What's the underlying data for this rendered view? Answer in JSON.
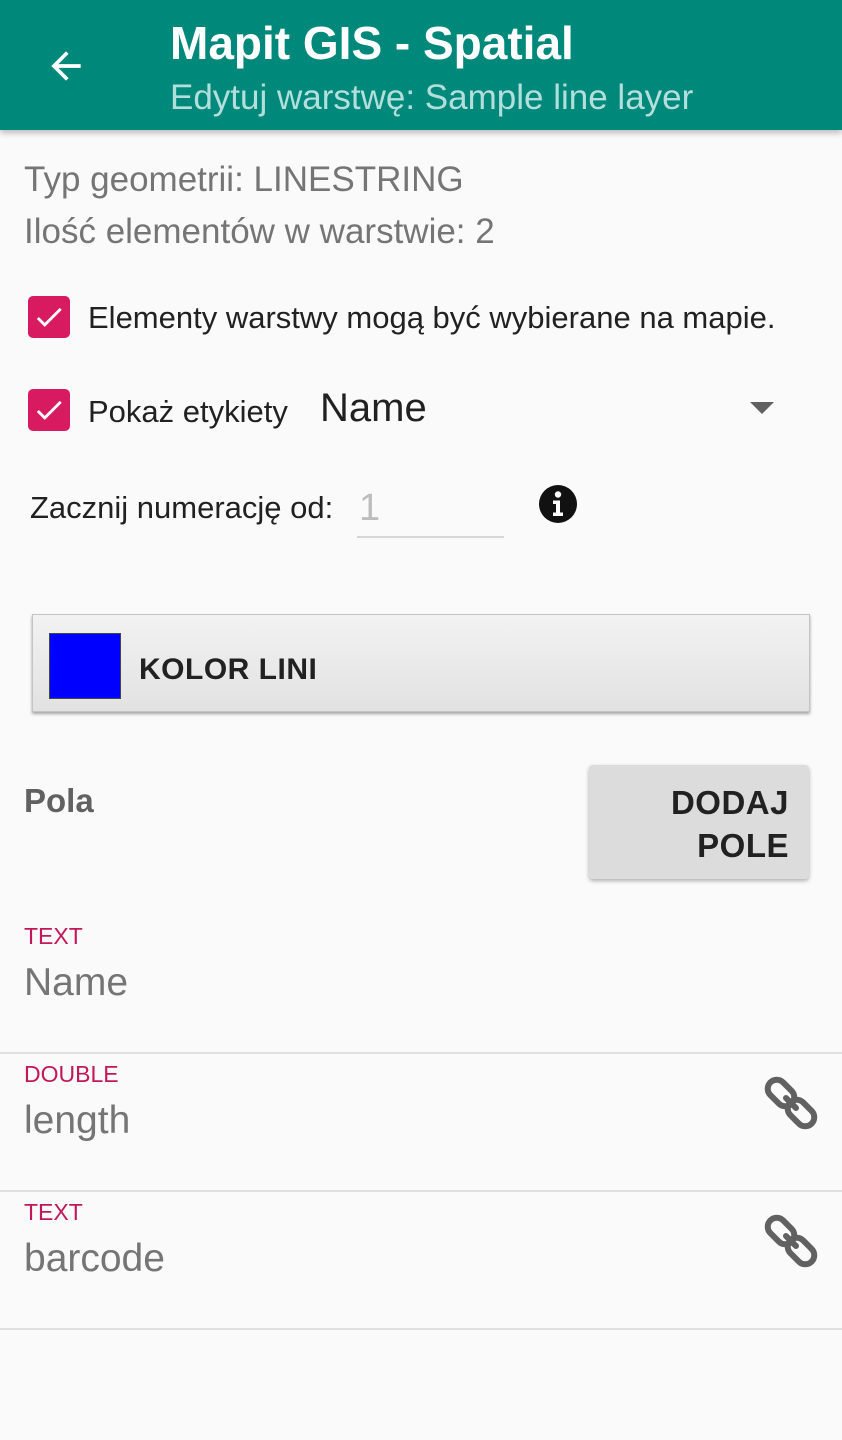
{
  "appbar": {
    "title": "Mapit GIS - Spatial",
    "subtitle": "Edytuj warstwę: Sample line layer",
    "back_icon": "arrow-left-icon"
  },
  "info": {
    "geometry_type": "Typ geometrii: LINESTRING",
    "feature_count": "Ilość elementów w warstwie: 2"
  },
  "options": {
    "selectable_label": "Elementy warstwy mogą być wybierane na mapie.",
    "selectable_checked": true,
    "show_labels_label": "Pokaż etykiety",
    "show_labels_checked": true,
    "label_field": "Name"
  },
  "numbering": {
    "label": "Zacznij numerację od:",
    "placeholder": "1",
    "info_icon": "info-icon"
  },
  "color_button": {
    "label": "KOLOR LINI",
    "color": "#0000ff"
  },
  "fields_section": {
    "title": "Pola",
    "add_button": "DODAJ POLE"
  },
  "fields": [
    {
      "type": "TEXT",
      "name": "Name",
      "linked": false
    },
    {
      "type": "DOUBLE",
      "name": "length",
      "linked": true
    },
    {
      "type": "TEXT",
      "name": "barcode",
      "linked": true
    }
  ],
  "colors": {
    "primary": "#00897b",
    "accent": "#d81b60",
    "type_label": "#c2185b"
  }
}
